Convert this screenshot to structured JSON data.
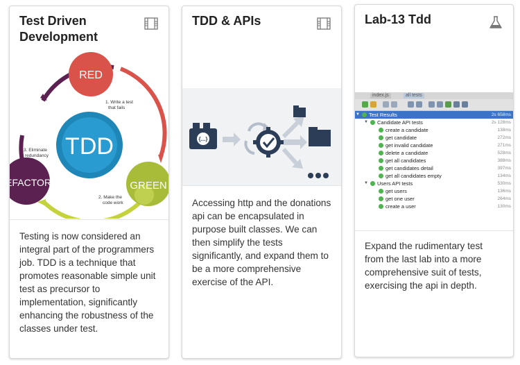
{
  "cards": [
    {
      "title": "Test Driven Development",
      "icon": "film-icon",
      "diagram": {
        "center": "TDD",
        "red": "RED",
        "green": "GREEN",
        "refactor": "REFACTOR",
        "step1": [
          "1. Write a test",
          "that fails"
        ],
        "step2": [
          "2. Make the",
          "code work"
        ],
        "step3": [
          "3. Eliminate",
          "redundancy"
        ]
      },
      "description": "Testing is now considered an integral part of the programmers job. TDD is a technique that promotes reasonable simple unit test as precursor to implementation, significantly enhancing the robustness of the classes under test."
    },
    {
      "title": "TDD & APIs",
      "icon": "film-icon",
      "diagram": {
        "brace_label": "{...}"
      },
      "description": "Accessing http and the donations api can be encapsulated in purpose built classes. We can then simplify the tests significantly, and expand them to be a more comprehensive exercise of the API."
    },
    {
      "title": "Lab-13 Tdd",
      "icon": "flask-icon",
      "panel": {
        "tabs": [
          "index.js",
          "all tests"
        ],
        "rows": [
          {
            "label": "Test Results",
            "time": "2s 658ms",
            "level": 0,
            "selected": true,
            "group": true
          },
          {
            "label": "Candidate API tests",
            "time": "2s 128ms",
            "level": 1,
            "group": true
          },
          {
            "label": "create a candidate",
            "time": "138ms",
            "level": 2
          },
          {
            "label": "get candidate",
            "time": "272ms",
            "level": 2
          },
          {
            "label": "get invalid candidate",
            "time": "271ms",
            "level": 2
          },
          {
            "label": "delete a candidate",
            "time": "528ms",
            "level": 2
          },
          {
            "label": "get all candidates",
            "time": "388ms",
            "level": 2
          },
          {
            "label": "get candidates detail",
            "time": "397ms",
            "level": 2
          },
          {
            "label": "get all candidates empty",
            "time": "134ms",
            "level": 2
          },
          {
            "label": "Users API tests",
            "time": "530ms",
            "level": 1,
            "group": true
          },
          {
            "label": "get users",
            "time": "136ms",
            "level": 2
          },
          {
            "label": "get one user",
            "time": "264ms",
            "level": 2
          },
          {
            "label": "create a user",
            "time": "130ms",
            "level": 2
          }
        ]
      },
      "description": "Expand the rudimentary test from the last lab into a more comprehensive suit of tests, exercising the api in depth."
    }
  ],
  "colors": {
    "red": "#d9534a",
    "green": "#a8bc3a",
    "refactor": "#5b2150",
    "tdd": "#1f86b8",
    "icon_dark": "#3a4d68"
  }
}
